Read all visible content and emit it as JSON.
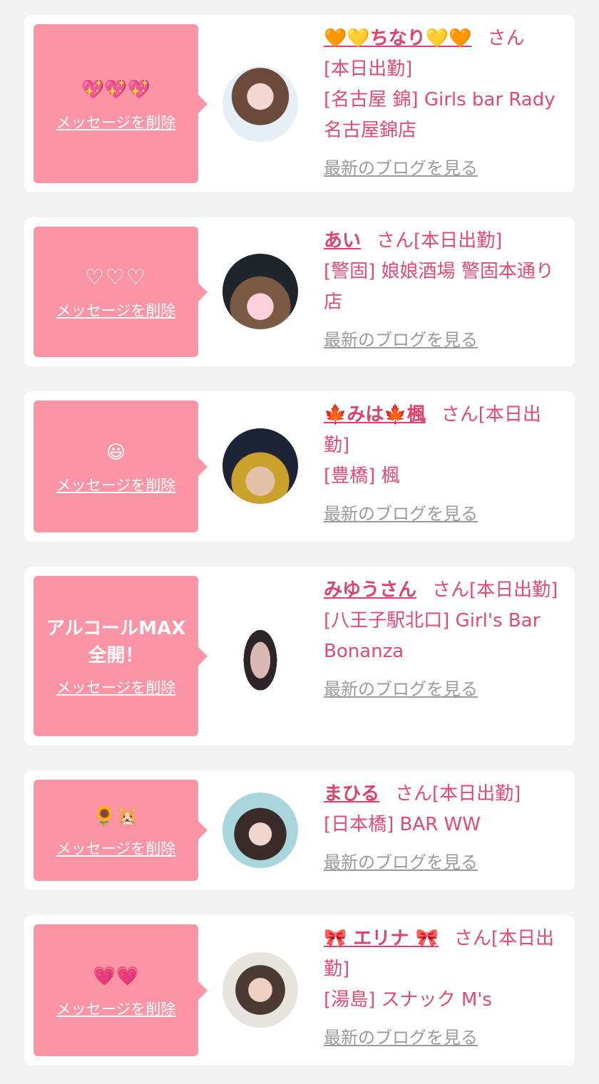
{
  "cards": [
    {
      "message": "💖💖💖",
      "delete_label": "メッセージを削除",
      "name": "🧡💛ちなり💛🧡",
      "suffix": "さん",
      "status": "[本日出勤]",
      "shop": "[名古屋 錦] Girls bar Rady 名古屋錦店",
      "blog_label": "最新のブログを見る"
    },
    {
      "message": "♡♡♡",
      "delete_label": "メッセージを削除",
      "name": "あい",
      "suffix": "さん[本日出勤]",
      "status": "",
      "shop": "[警固] 娘娘酒場 警固本通り店",
      "blog_label": "最新のブログを見る"
    },
    {
      "message": "😃",
      "delete_label": "メッセージを削除",
      "name": "🍁みは🍁楓",
      "suffix": "さん[本日出勤]",
      "status": "",
      "shop": "[豊橋] 楓",
      "blog_label": "最新のブログを見る"
    },
    {
      "message": "アルコールMAX全開！",
      "delete_label": "メッセージを削除",
      "name": "みゆうさん",
      "suffix": "さん[本日出勤]",
      "status": "",
      "shop": "[八王子駅北口] Girl's Bar Bonanza",
      "blog_label": "最新のブログを見る"
    },
    {
      "message": "🌻🐹",
      "delete_label": "メッセージを削除",
      "name": "まひる",
      "suffix": "さん[本日出勤]",
      "status": "",
      "shop": "[日本橋] BAR WW",
      "blog_label": "最新のブログを見る"
    },
    {
      "message": "💗💗",
      "delete_label": "メッセージを削除",
      "name": "🎀 エリナ 🎀",
      "suffix": "さん[本日出勤]",
      "status": "",
      "shop": "[湯島] スナック M's",
      "blog_label": "最新のブログを見る"
    }
  ],
  "colors": {
    "accent": "#e24a74",
    "bubble": "#fb94a5",
    "background": "#f2f2f2",
    "blog_link": "#9a9a9a"
  }
}
